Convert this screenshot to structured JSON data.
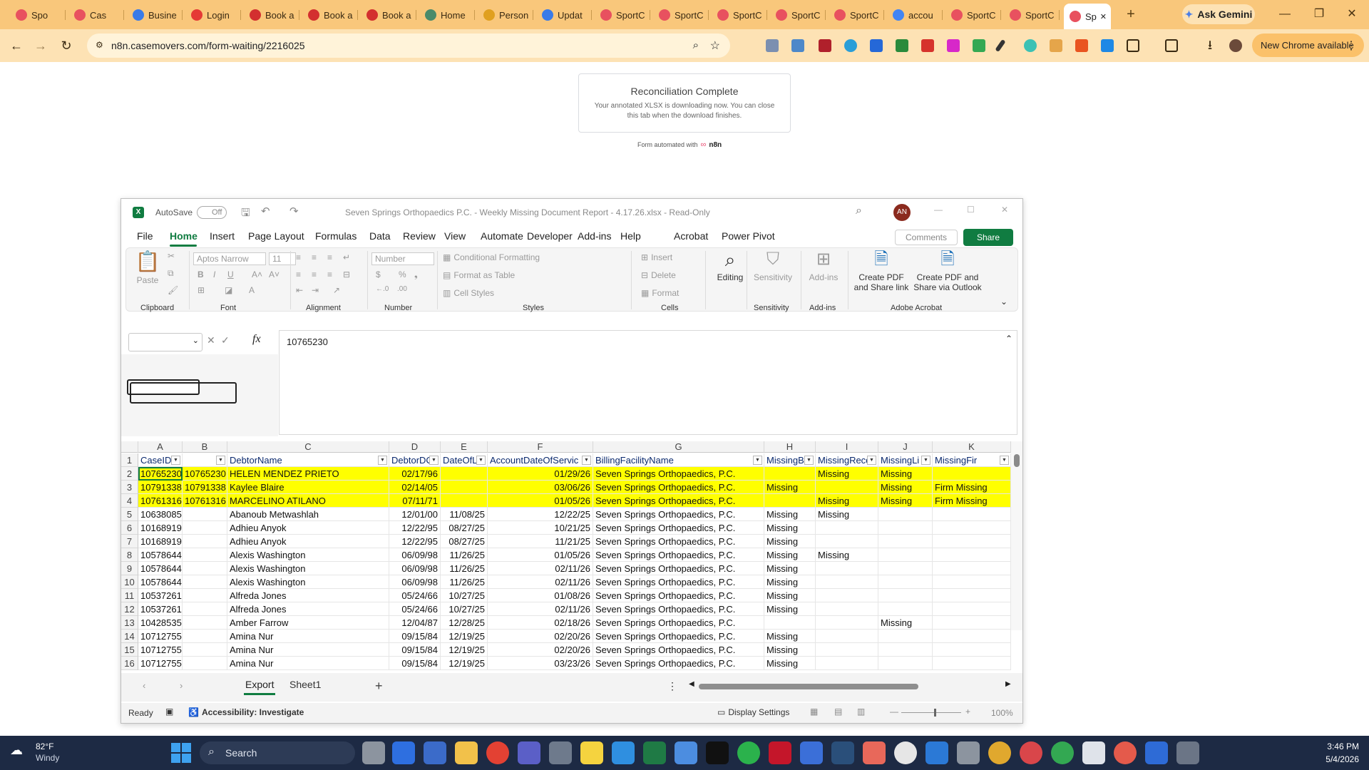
{
  "browser": {
    "tabs": [
      {
        "label": "Spo",
        "icon": "n8n-icon"
      },
      {
        "label": "Cas",
        "icon": "n8n-icon"
      },
      {
        "label": "Busine",
        "icon": "gear-icon"
      },
      {
        "label": "Login",
        "icon": "circle-icon"
      },
      {
        "label": "Book a",
        "icon": "n-icon"
      },
      {
        "label": "Book a",
        "icon": "n-icon"
      },
      {
        "label": "Book a",
        "icon": "n-icon"
      },
      {
        "label": "Home",
        "icon": "globe-icon"
      },
      {
        "label": "Person",
        "icon": "doc-icon"
      },
      {
        "label": "Updat",
        "icon": "gear-icon"
      },
      {
        "label": "SportC",
        "icon": "n8n-icon"
      },
      {
        "label": "SportC",
        "icon": "n8n-icon"
      },
      {
        "label": "SportC",
        "icon": "n8n-icon"
      },
      {
        "label": "SportC",
        "icon": "n8n-icon"
      },
      {
        "label": "SportC",
        "icon": "n8n-icon"
      },
      {
        "label": "accou",
        "icon": "google-icon"
      },
      {
        "label": "SportC",
        "icon": "n8n-icon"
      },
      {
        "label": "SportC",
        "icon": "n8n-icon"
      },
      {
        "label": "Sp",
        "icon": "n8n-icon"
      }
    ],
    "gemini_label": "Ask Gemini",
    "url": "n8n.casemovers.com/form-waiting/2216025",
    "new_chrome": "New Chrome available",
    "accent": "#f9c77b"
  },
  "page": {
    "title": "Reconciliation Complete",
    "message": "Your annotated XLSX is downloading now. You can close this tab when the download finishes.",
    "footer_prefix": "Form automated with",
    "footer_brand": "n8n"
  },
  "excel": {
    "autosave": "AutoSave",
    "autosave_state": "Off",
    "title": "Seven Springs Orthopaedics P.C. - Weekly Missing Document Report - 4.17.26.xlsx  -  Read-Only",
    "avatar": "AN",
    "menu": [
      "File",
      "Home",
      "Insert",
      "Page Layout",
      "Formulas",
      "Data",
      "Review",
      "View",
      "Automate",
      "Developer",
      "Add-ins",
      "Help",
      "Acrobat",
      "Power Pivot"
    ],
    "comments": "Comments",
    "share": "Share",
    "ribbon": {
      "paste": "Paste",
      "font_name": "Aptos Narrow",
      "font_size": "11",
      "number_format": "Number",
      "conditional_formatting": "Conditional Formatting",
      "format_as_table": "Format as Table",
      "cell_styles": "Cell Styles",
      "insert": "Insert",
      "delete": "Delete",
      "format": "Format",
      "editing": "Editing",
      "sensitivity": "Sensitivity",
      "addins": "Add-ins",
      "create_pdf_share": "Create PDF and Share link",
      "create_pdf_outlook": "Create PDF and Share via Outlook",
      "groups": [
        "Clipboard",
        "Font",
        "Alignment",
        "Number",
        "Styles",
        "Cells",
        "Sensitivity",
        "Add-ins",
        "Adobe Acrobat"
      ]
    },
    "formula_value": "10765230",
    "columns": [
      "A",
      "B",
      "C",
      "D",
      "E",
      "F",
      "G",
      "H",
      "I",
      "J",
      "K"
    ],
    "headers": [
      "CaseID",
      "",
      "DebtorName",
      "DebtorDC",
      "DateOfLo",
      "AccountDateOfServic",
      "BillingFacilityName",
      "MissingB",
      "MissingReco",
      "MissingLi",
      "MissingFir"
    ],
    "rows": [
      {
        "n": "2",
        "cells": [
          "10765230",
          "10765230",
          "HELEN MENDEZ PRIETO",
          "02/17/96",
          "",
          "01/29/26",
          "Seven Springs Orthopaedics, P.C.",
          "",
          "Missing",
          "Missing",
          ""
        ],
        "hl": true
      },
      {
        "n": "3",
        "cells": [
          "10791338",
          "10791338",
          "Kaylee Blaire",
          "02/14/05",
          "",
          "03/06/26",
          "Seven Springs Orthopaedics, P.C.",
          "Missing",
          "",
          "Missing",
          "Firm Missing"
        ],
        "hl": true
      },
      {
        "n": "4",
        "cells": [
          "10761316",
          "10761316",
          "MARCELINO ATILANO",
          "07/11/71",
          "",
          "01/05/26",
          "Seven Springs Orthopaedics, P.C.",
          "",
          "Missing",
          "Missing",
          "Firm Missing"
        ],
        "hl": true
      },
      {
        "n": "5",
        "cells": [
          "10638085",
          "",
          "Abanoub Metwashlah",
          "12/01/00",
          "11/08/25",
          "12/22/25",
          "Seven Springs Orthopaedics, P.C.",
          "Missing",
          "Missing",
          "",
          ""
        ]
      },
      {
        "n": "6",
        "cells": [
          "10168919",
          "",
          "Adhieu Anyok",
          "12/22/95",
          "08/27/25",
          "10/21/25",
          "Seven Springs Orthopaedics, P.C.",
          "Missing",
          "",
          "",
          ""
        ]
      },
      {
        "n": "7",
        "cells": [
          "10168919",
          "",
          "Adhieu Anyok",
          "12/22/95",
          "08/27/25",
          "11/21/25",
          "Seven Springs Orthopaedics, P.C.",
          "Missing",
          "",
          "",
          ""
        ]
      },
      {
        "n": "8",
        "cells": [
          "10578644",
          "",
          "Alexis Washington",
          "06/09/98",
          "11/26/25",
          "01/05/26",
          "Seven Springs Orthopaedics, P.C.",
          "Missing",
          "Missing",
          "",
          ""
        ]
      },
      {
        "n": "9",
        "cells": [
          "10578644",
          "",
          "Alexis Washington",
          "06/09/98",
          "11/26/25",
          "02/11/26",
          "Seven Springs Orthopaedics, P.C.",
          "Missing",
          "",
          "",
          ""
        ]
      },
      {
        "n": "10",
        "cells": [
          "10578644",
          "",
          "Alexis Washington",
          "06/09/98",
          "11/26/25",
          "02/11/26",
          "Seven Springs Orthopaedics, P.C.",
          "Missing",
          "",
          "",
          ""
        ]
      },
      {
        "n": "11",
        "cells": [
          "10537261",
          "",
          "Alfreda Jones",
          "05/24/66",
          "10/27/25",
          "01/08/26",
          "Seven Springs Orthopaedics, P.C.",
          "Missing",
          "",
          "",
          ""
        ]
      },
      {
        "n": "12",
        "cells": [
          "10537261",
          "",
          "Alfreda Jones",
          "05/24/66",
          "10/27/25",
          "02/11/26",
          "Seven Springs Orthopaedics, P.C.",
          "Missing",
          "",
          "",
          ""
        ]
      },
      {
        "n": "13",
        "cells": [
          "10428535",
          "",
          "Amber Farrow",
          "12/04/87",
          "12/28/25",
          "02/18/26",
          "Seven Springs Orthopaedics, P.C.",
          "",
          "",
          "Missing",
          ""
        ]
      },
      {
        "n": "14",
        "cells": [
          "10712755",
          "",
          "Amina Nur",
          "09/15/84",
          "12/19/25",
          "02/20/26",
          "Seven Springs Orthopaedics, P.C.",
          "Missing",
          "",
          "",
          ""
        ]
      },
      {
        "n": "15",
        "cells": [
          "10712755",
          "",
          "Amina Nur",
          "09/15/84",
          "12/19/25",
          "02/20/26",
          "Seven Springs Orthopaedics, P.C.",
          "Missing",
          "",
          "",
          ""
        ]
      },
      {
        "n": "16",
        "cells": [
          "10712755",
          "",
          "Amina Nur",
          "09/15/84",
          "12/19/25",
          "03/23/26",
          "Seven Springs Orthopaedics, P.C.",
          "Missing",
          "",
          "",
          ""
        ]
      }
    ],
    "sheets": [
      "Export",
      "Sheet1"
    ],
    "status_ready": "Ready",
    "accessibility": "Accessibility: Investigate",
    "display_settings": "Display Settings",
    "zoom": "100%"
  },
  "taskbar": {
    "weather_temp": "82°F",
    "weather_desc": "Windy",
    "search": "Search",
    "time": "3:46 PM",
    "date": "5/4/2026"
  }
}
